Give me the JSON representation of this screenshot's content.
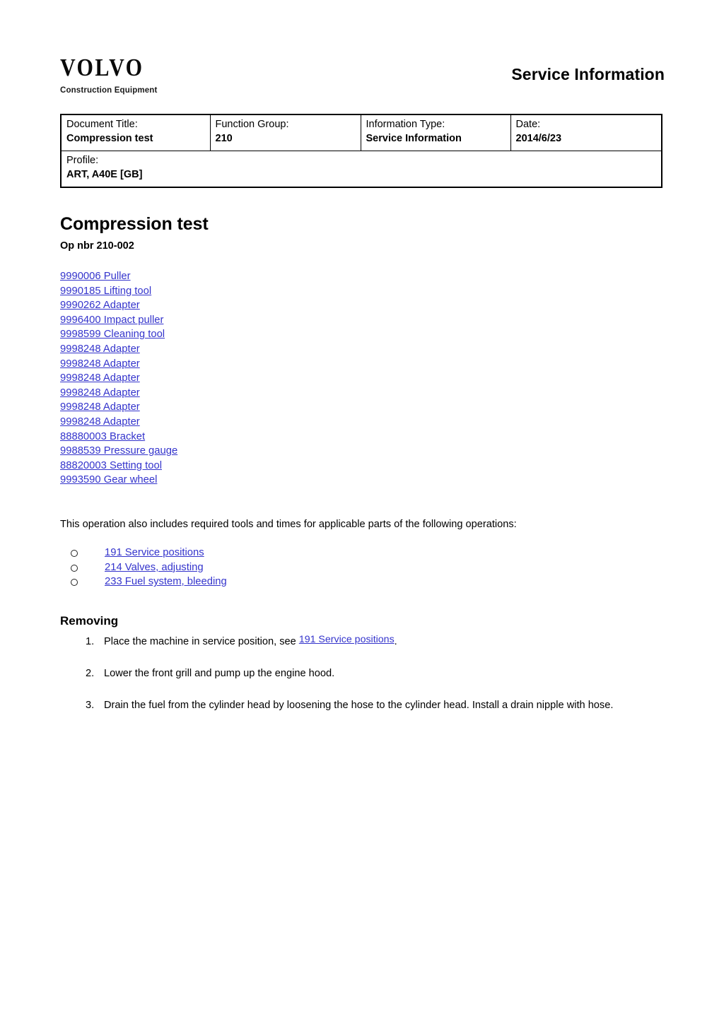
{
  "header": {
    "logo_wordmark": "VOLVO",
    "logo_subtitle": "Construction Equipment",
    "title": "Service Information"
  },
  "meta_table": {
    "row1": [
      {
        "label": "Document Title:",
        "value": "Compression test"
      },
      {
        "label": "Function Group:",
        "value": "210"
      },
      {
        "label": "Information Type:",
        "value": "Service Information"
      },
      {
        "label": "Date:",
        "value": "2014/6/23"
      }
    ],
    "row2": {
      "label": "Profile:",
      "value": "ART, A40E [GB]"
    }
  },
  "document": {
    "title": "Compression test",
    "op_nbr": "Op nbr 210-002",
    "tools": [
      "9990006 Puller",
      "9990185 Lifting tool",
      "9990262 Adapter",
      "9996400 Impact puller",
      "9998599 Cleaning tool",
      "9998248 Adapter",
      "9998248 Adapter",
      "9998248 Adapter",
      "9998248 Adapter",
      "9998248 Adapter",
      "9998248 Adapter",
      "88880003 Bracket",
      "9988539 Pressure gauge",
      "88820003 Setting tool",
      "9993590 Gear wheel"
    ],
    "intro_paragraph": "This operation also includes required tools and times for applicable parts of the following operations:",
    "related_operations": [
      "191 Service positions",
      "214 Valves, adjusting",
      "233 Fuel system, bleeding"
    ],
    "section_heading": "Removing",
    "steps": [
      {
        "number": "1.",
        "text_before": "Place the machine in service position, see ",
        "link": "191 Service positions",
        "text_after": "."
      },
      {
        "number": "2.",
        "text_before": "Lower the front grill and pump up the engine hood.",
        "link": "",
        "text_after": ""
      },
      {
        "number": "3.",
        "text_before": "Drain the fuel from the cylinder head by loosening the hose to the cylinder head. Install a drain nipple with hose.",
        "link": "",
        "text_after": ""
      }
    ]
  },
  "colors": {
    "link": "#3434cc",
    "text": "#000000",
    "background": "#ffffff",
    "border": "#000000"
  }
}
